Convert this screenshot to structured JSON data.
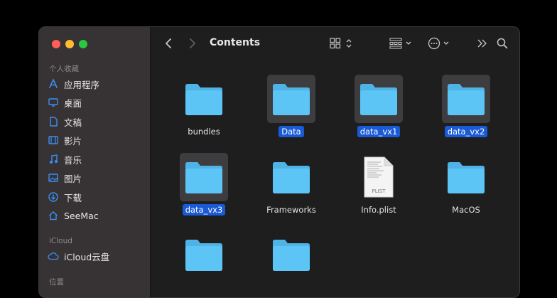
{
  "window": {
    "title": "Contents"
  },
  "sidebar": {
    "sections": [
      {
        "title": "个人收藏",
        "items": [
          {
            "label": "应用程序",
            "icon": "apps-icon"
          },
          {
            "label": "桌面",
            "icon": "desktop-icon"
          },
          {
            "label": "文稿",
            "icon": "document-icon"
          },
          {
            "label": "影片",
            "icon": "film-icon"
          },
          {
            "label": "音乐",
            "icon": "music-icon"
          },
          {
            "label": "图片",
            "icon": "photo-icon"
          },
          {
            "label": "下载",
            "icon": "download-icon"
          },
          {
            "label": "SeeMac",
            "icon": "home-icon"
          }
        ]
      },
      {
        "title": "iCloud",
        "items": [
          {
            "label": "iCloud云盘",
            "icon": "cloud-icon"
          }
        ]
      },
      {
        "title": "位置",
        "items": []
      }
    ]
  },
  "toolbar": {
    "back_icon": "chevron-left-icon",
    "forward_icon": "chevron-right-icon",
    "view_icon": "grid-view-icon",
    "group_icon": "group-icon",
    "more_icon": "ellipsis-circle-icon",
    "expand_icon": "double-chevron-icon",
    "search_icon": "search-icon"
  },
  "files": [
    {
      "name": "bundles",
      "type": "folder",
      "selected": false
    },
    {
      "name": "Data",
      "type": "folder",
      "selected": true
    },
    {
      "name": "data_vx1",
      "type": "folder",
      "selected": true
    },
    {
      "name": "data_vx2",
      "type": "folder",
      "selected": true
    },
    {
      "name": "data_vx3",
      "type": "folder",
      "selected": true
    },
    {
      "name": "Frameworks",
      "type": "folder",
      "selected": false
    },
    {
      "name": "Info.plist",
      "type": "plist",
      "selected": false,
      "badge": "PLIST"
    },
    {
      "name": "MacOS",
      "type": "folder",
      "selected": false
    },
    {
      "name": "",
      "type": "folder",
      "selected": false
    },
    {
      "name": "",
      "type": "folder",
      "selected": false
    }
  ],
  "colors": {
    "folder": "#5cc5f6",
    "folder_tab": "#4fb3e6",
    "accent": "#1a5ad6",
    "sidebar_icon": "#3b8ff2"
  }
}
